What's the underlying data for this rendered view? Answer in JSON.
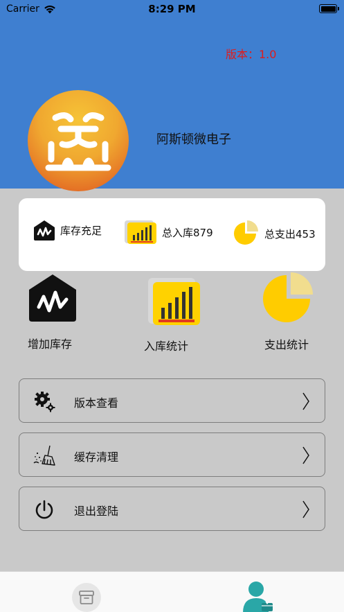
{
  "status_bar": {
    "carrier": "Carrier",
    "time": "8:29 PM"
  },
  "header": {
    "version_text": "版本：1.0",
    "company_name": "阿斯顿微电子"
  },
  "summary": {
    "stock_label": "库存充足",
    "inbound_label": "总入库879",
    "outbound_label": "总支出453"
  },
  "actions": {
    "add_stock": "增加库存",
    "inbound_stats": "入库统计",
    "outbound_stats": "支出统计"
  },
  "menu": {
    "version_check": "版本查看",
    "clear_cache": "缓存清理",
    "logout": "退出登陆"
  },
  "colors": {
    "header_bg": "#3f7fd0",
    "version_red": "#e01b1b",
    "icon_yellow": "#ffcc00",
    "tab_active": "#2aa7a7"
  },
  "icons": {
    "tab_home": "box-icon",
    "tab_profile": "user-icon"
  }
}
